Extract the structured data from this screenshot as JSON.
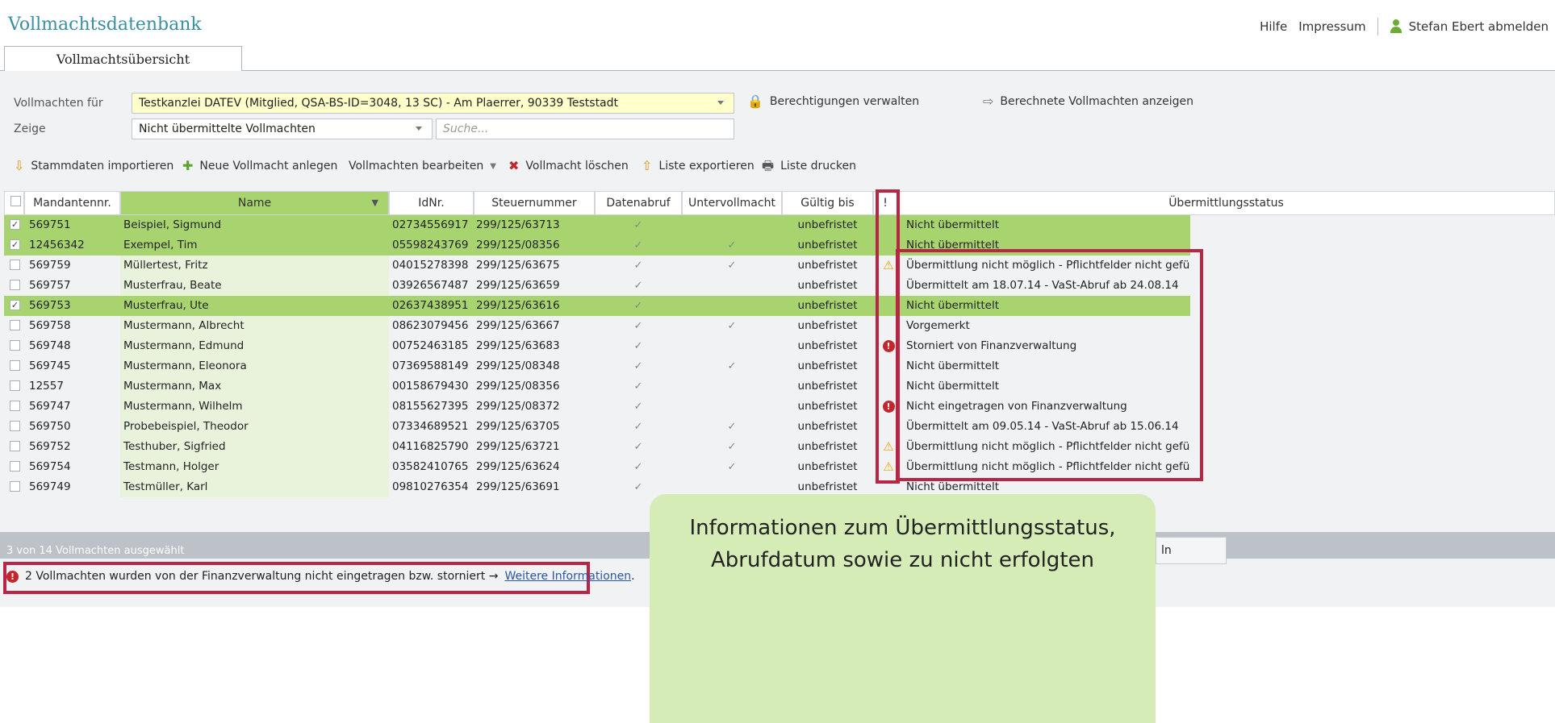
{
  "app": {
    "title": "Vollmachtsdatenbank"
  },
  "toplinks": {
    "help": "Hilfe",
    "imprint": "Impressum",
    "user_logout": "Stefan Ebert abmelden"
  },
  "tab": {
    "label": "Vollmachtsübersicht"
  },
  "filters": {
    "for_label": "Vollmachten für",
    "for_value": "Testkanzlei DATEV (Mitglied, QSA-BS-ID=3048, 13 SC) - Am Plaerrer, 90339 Teststadt",
    "show_label": "Zeige",
    "show_value": "Nicht übermittelte Vollmachten",
    "search_placeholder": "Suche...",
    "manage_permissions": "Berechtigungen verwalten",
    "show_calculated": "Berechnete Vollmachten anzeigen"
  },
  "toolbar": {
    "import": "Stammdaten importieren",
    "new": "Neue Vollmacht anlegen",
    "edit": "Vollmachten bearbeiten",
    "delete": "Vollmacht löschen",
    "export": "Liste exportieren",
    "print": "Liste drucken"
  },
  "table": {
    "headers": [
      "Mandantennr.",
      "Name",
      "IdNr.",
      "Steuernummer",
      "Datenabruf",
      "Untervollmacht",
      "Gültig bis",
      "!",
      "Übermittlungsstatus"
    ],
    "rows": [
      {
        "nr": "569751",
        "name": "Beispiel, Sigmund",
        "idnr": "02734556917",
        "st": "299/125/63713",
        "abruf": "✓",
        "unter": "",
        "gueltig": "unbefristet",
        "flag": "",
        "status": "Nicht übermittelt",
        "selected": true
      },
      {
        "nr": "12456342",
        "name": "Exempel, Tim",
        "idnr": "05598243769",
        "st": "299/125/08356",
        "abruf": "✓",
        "unter": "✓",
        "gueltig": "unbefristet",
        "flag": "",
        "status": "Nicht übermittelt",
        "selected": true
      },
      {
        "nr": "569759",
        "name": "Müllertest, Fritz",
        "idnr": "04015278398",
        "st": "299/125/63675",
        "abruf": "✓",
        "unter": "✓",
        "gueltig": "unbefristet",
        "flag": "warn",
        "status": "Übermittlung nicht möglich - Pflichtfelder nicht gefüllt",
        "selected": false
      },
      {
        "nr": "569757",
        "name": "Musterfrau, Beate",
        "idnr": "03926567487",
        "st": "299/125/63659",
        "abruf": "✓",
        "unter": "",
        "gueltig": "unbefristet",
        "flag": "",
        "status": "Übermittelt am 18.07.14 - VaSt-Abruf ab 24.08.14",
        "selected": false
      },
      {
        "nr": "569753",
        "name": "Musterfrau, Ute",
        "idnr": "02637438951",
        "st": "299/125/63616",
        "abruf": "✓",
        "unter": "",
        "gueltig": "unbefristet",
        "flag": "",
        "status": "Nicht übermittelt",
        "selected": true
      },
      {
        "nr": "569758",
        "name": "Mustermann, Albrecht",
        "idnr": "08623079456",
        "st": "299/125/63667",
        "abruf": "✓",
        "unter": "✓",
        "gueltig": "unbefristet",
        "flag": "",
        "status": "Vorgemerkt",
        "selected": false
      },
      {
        "nr": "569748",
        "name": "Mustermann, Edmund",
        "idnr": "00752463185",
        "st": "299/125/63683",
        "abruf": "✓",
        "unter": "",
        "gueltig": "unbefristet",
        "flag": "err",
        "status": "Storniert von Finanzverwaltung",
        "selected": false
      },
      {
        "nr": "569745",
        "name": "Mustermann, Eleonora",
        "idnr": "07369588149",
        "st": "299/125/08348",
        "abruf": "✓",
        "unter": "✓",
        "gueltig": "unbefristet",
        "flag": "",
        "status": "Nicht übermittelt",
        "selected": false
      },
      {
        "nr": "12557",
        "name": "Mustermann, Max",
        "idnr": "00158679430",
        "st": "299/125/08356",
        "abruf": "✓",
        "unter": "",
        "gueltig": "unbefristet",
        "flag": "",
        "status": "Nicht übermittelt",
        "selected": false
      },
      {
        "nr": "569747",
        "name": "Mustermann, Wilhelm",
        "idnr": "08155627395",
        "st": "299/125/08372",
        "abruf": "✓",
        "unter": "",
        "gueltig": "unbefristet",
        "flag": "err",
        "status": "Nicht eingetragen von Finanzverwaltung",
        "selected": false
      },
      {
        "nr": "569750",
        "name": "Probebeispiel, Theodor",
        "idnr": "07334689521",
        "st": "299/125/63705",
        "abruf": "✓",
        "unter": "✓",
        "gueltig": "unbefristet",
        "flag": "",
        "status": "Übermittelt am 09.05.14 - VaSt-Abruf ab 15.06.14",
        "selected": false
      },
      {
        "nr": "569752",
        "name": "Testhuber, Sigfried",
        "idnr": "04116825790",
        "st": "299/125/63721",
        "abruf": "✓",
        "unter": "✓",
        "gueltig": "unbefristet",
        "flag": "warn",
        "status": "Übermittlung nicht möglich - Pflichtfelder nicht gefüllt",
        "selected": false
      },
      {
        "nr": "569754",
        "name": "Testmann, Holger",
        "idnr": "03582410765",
        "st": "299/125/63624",
        "abruf": "✓",
        "unter": "✓",
        "gueltig": "unbefristet",
        "flag": "warn",
        "status": "Übermittlung nicht möglich - Pflichtfelder nicht gefüllt",
        "selected": false
      },
      {
        "nr": "569749",
        "name": "Testmüller, Karl",
        "idnr": "09810276354",
        "st": "299/125/63691",
        "abruf": "✓",
        "unter": "",
        "gueltig": "unbefristet",
        "flag": "",
        "status": "Nicht übermittelt",
        "selected": false
      }
    ]
  },
  "footer": {
    "selection": "3 von 14 Vollmachten ausgewählt",
    "notice": "2 Vollmachten wurden von der Finanzverwaltung nicht eingetragen bzw. storniert →",
    "notice_link": "Weitere Informationen",
    "notice_end": ".",
    "button_fragment": "ln"
  },
  "callout": {
    "line1": "Informationen zum Übermittlungsstatus,",
    "line2": "Abrufdatum sowie zu nicht erfolgten"
  }
}
